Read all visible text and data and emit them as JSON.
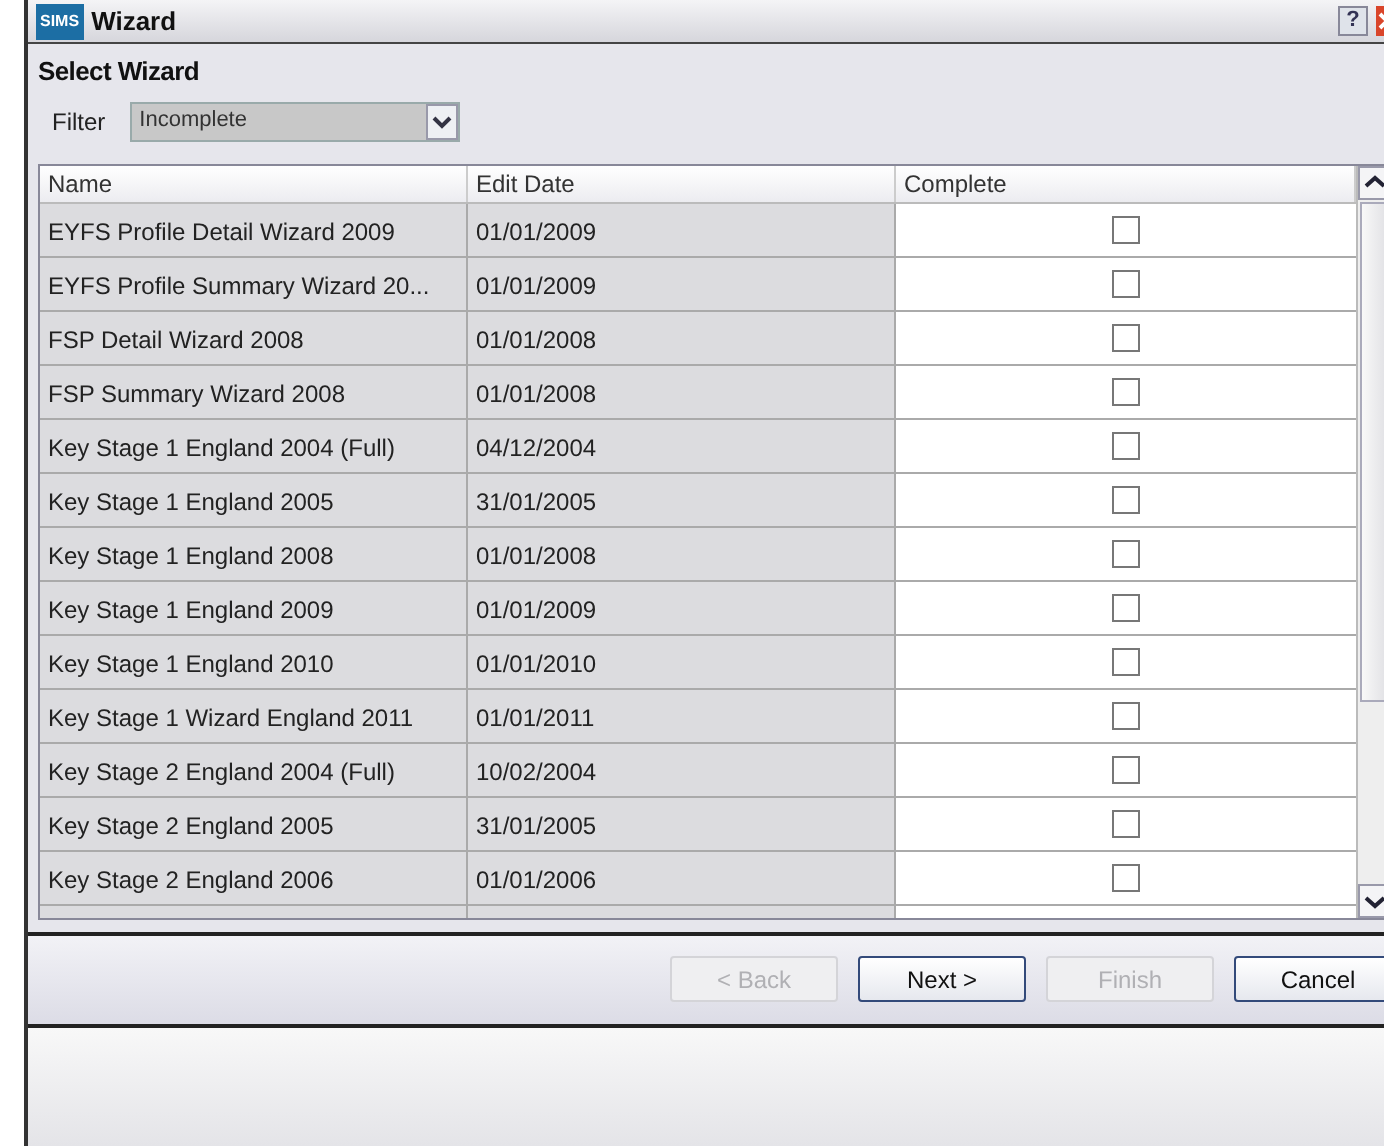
{
  "window": {
    "title": "Wizard",
    "logo": "SIMS",
    "help": "?"
  },
  "heading": "Select Wizard",
  "filter": {
    "label": "Filter",
    "value": "Incomplete"
  },
  "table": {
    "columns": [
      "Name",
      "Edit Date",
      "Complete"
    ],
    "rows": [
      {
        "name": "EYFS Profile Detail Wizard 2009",
        "date": "01/01/2009",
        "complete": false
      },
      {
        "name": "EYFS Profile Summary Wizard 20...",
        "date": "01/01/2009",
        "complete": false
      },
      {
        "name": "FSP Detail Wizard 2008",
        "date": "01/01/2008",
        "complete": false
      },
      {
        "name": "FSP Summary Wizard 2008",
        "date": "01/01/2008",
        "complete": false
      },
      {
        "name": "Key Stage 1 England 2004 (Full)",
        "date": "04/12/2004",
        "complete": false
      },
      {
        "name": "Key Stage 1 England 2005",
        "date": "31/01/2005",
        "complete": false
      },
      {
        "name": "Key Stage 1 England 2008",
        "date": "01/01/2008",
        "complete": false
      },
      {
        "name": "Key Stage 1 England 2009",
        "date": "01/01/2009",
        "complete": false
      },
      {
        "name": "Key Stage 1 England 2010",
        "date": "01/01/2010",
        "complete": false
      },
      {
        "name": "Key Stage 1 Wizard England 2011",
        "date": "01/01/2011",
        "complete": false
      },
      {
        "name": "Key Stage 2 England 2004 (Full)",
        "date": "10/02/2004",
        "complete": false
      },
      {
        "name": "Key Stage 2 England 2005",
        "date": "31/01/2005",
        "complete": false
      },
      {
        "name": "Key Stage 2 England 2006",
        "date": "01/01/2006",
        "complete": false
      }
    ]
  },
  "buttons": [
    {
      "label": "< Back",
      "disabled": true
    },
    {
      "label": "Next >",
      "disabled": false
    },
    {
      "label": "Finish",
      "disabled": true
    },
    {
      "label": "Cancel",
      "disabled": false
    }
  ]
}
